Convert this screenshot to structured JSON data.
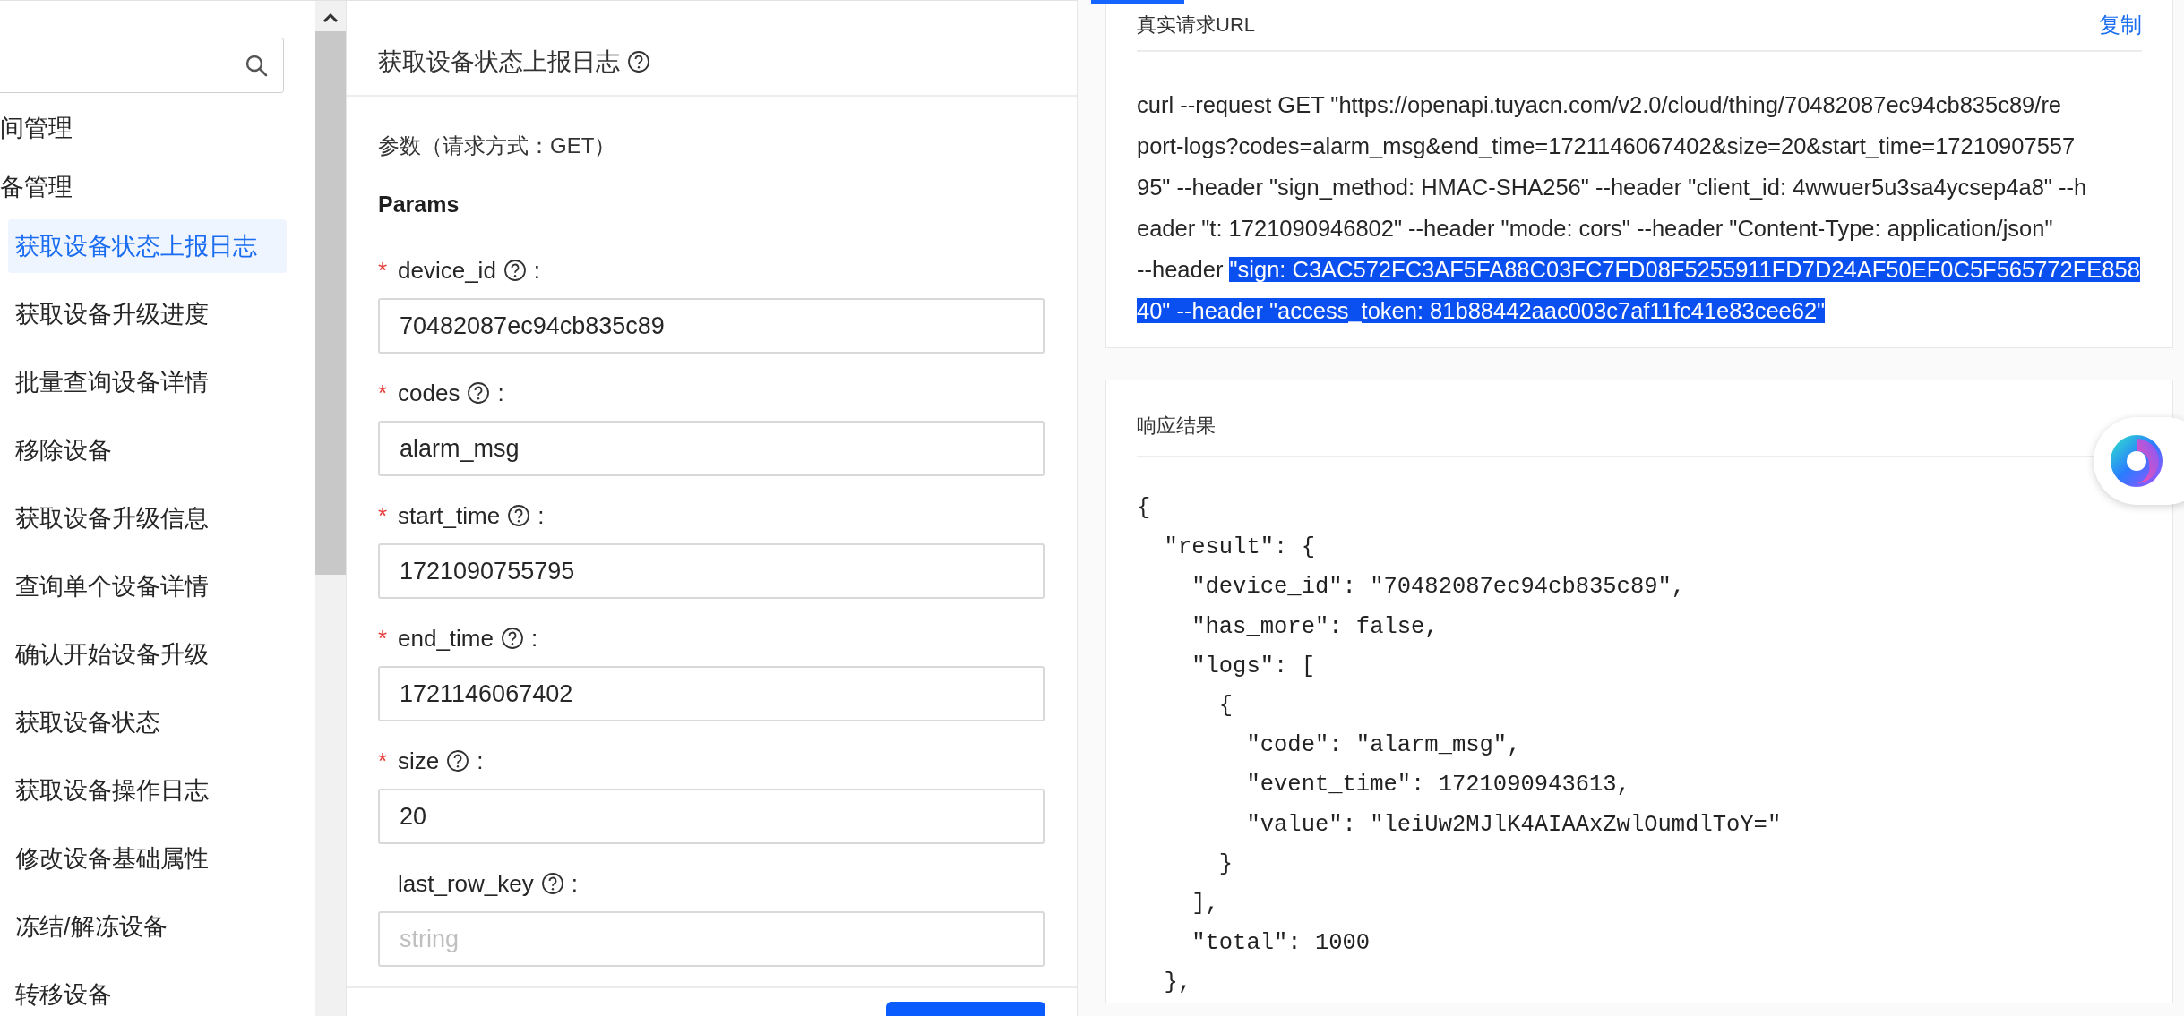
{
  "sidebar": {
    "groups": [
      {
        "label": "间管理"
      },
      {
        "label": "备管理",
        "children": [
          {
            "label": "获取设备状态上报日志",
            "selected": true
          },
          {
            "label": "获取设备升级进度",
            "selected": false
          },
          {
            "label": "批量查询设备详情",
            "selected": false
          },
          {
            "label": "移除设备",
            "selected": false
          },
          {
            "label": "获取设备升级信息",
            "selected": false
          },
          {
            "label": "查询单个设备详情",
            "selected": false
          },
          {
            "label": "确认开始设备升级",
            "selected": false
          },
          {
            "label": "获取设备状态",
            "selected": false
          },
          {
            "label": "获取设备操作日志",
            "selected": false
          },
          {
            "label": "修改设备基础属性",
            "selected": false
          },
          {
            "label": "冻结/解冻设备",
            "selected": false
          },
          {
            "label": "转移设备",
            "selected": false
          }
        ]
      }
    ]
  },
  "panel": {
    "title": "获取设备状态上报日志",
    "subtitle": "参数（请求方式：GET）",
    "section": "Params",
    "fields": [
      {
        "required_mark": "*",
        "label": "device_id",
        "suffix": ":",
        "value": "70482087ec94cb835c89"
      },
      {
        "required_mark": "*",
        "label": "codes",
        "suffix": ":",
        "value": "alarm_msg"
      },
      {
        "required_mark": "*",
        "label": "start_time",
        "suffix": ":",
        "value": "1721090755795"
      },
      {
        "required_mark": "*",
        "label": "end_time",
        "suffix": ":",
        "value": "1721146067402"
      },
      {
        "required_mark": "*",
        "label": "size",
        "suffix": ":",
        "value": "20"
      },
      {
        "label": "last_row_key",
        "suffix": ":",
        "placeholder": "string"
      }
    ],
    "submit": {
      "kind": "primary"
    }
  },
  "request_url": {
    "title": "真实请求URL",
    "copy": "复制",
    "lines": [
      [
        {
          "text": "curl --request GET \"https://openapi.tuyacn.com/v2.0/cloud/thing/70482087ec94cb835c89/re",
          "selected": false
        }
      ],
      [
        {
          "text": "port-logs?codes=alarm_msg&end_time=1721146067402&size=20&start_time=17210907557",
          "selected": false
        }
      ],
      [
        {
          "text": "95\" --header \"sign_method: HMAC-SHA256\" --header \"client_id: 4wwuer5u3sa4ycsep4a8\" --h",
          "selected": false
        }
      ],
      [
        {
          "text": "eader \"t: 1721090946802\" --header \"mode: cors\" --header \"Content-Type: application/json\"",
          "selected": false
        }
      ],
      [
        {
          "text": "--header ",
          "selected": false
        },
        {
          "text": "\"sign: C3AC572FC3AF5FA88C03FC7FD08F5255911FD7D24AF50EF0C5F565772FE858",
          "selected": true
        }
      ],
      [
        {
          "text": "40\" --header \"access_token: 81b88442aac003c7af11fc41e83cee62\"",
          "selected": true
        }
      ]
    ]
  },
  "response": {
    "title": "响应结果",
    "lines": [
      "{",
      "  \"result\": {",
      "    \"device_id\": \"70482087ec94cb835c89\",",
      "    \"has_more\": false,",
      "    \"logs\": [",
      "      {",
      "        \"code\": \"alarm_msg\",",
      "        \"event_time\": 1721090943613,",
      "        \"value\": \"leiUw2MJlK4AIAAxZwlOumdlToY=\"",
      "      }",
      "    ],",
      "    \"total\": 1000",
      "  },"
    ]
  }
}
